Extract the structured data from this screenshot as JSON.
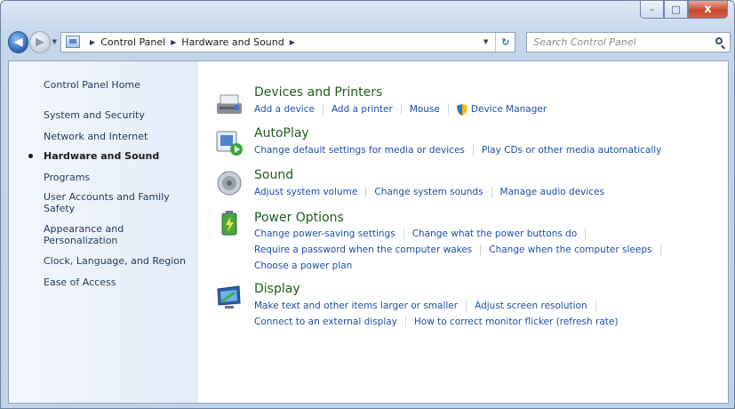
{
  "window": {
    "caption_buttons": {
      "minimize": "–",
      "maximize": "□",
      "close": "x"
    }
  },
  "nav": {
    "back_glyph": "◀",
    "forward_glyph": "▶",
    "dropdown_glyph": "▼"
  },
  "address": {
    "separator_glyph": "▶",
    "crumbs": [
      "Control Panel",
      "Hardware and Sound"
    ],
    "dropdown_glyph": "▼",
    "refresh_glyph": "↻"
  },
  "search": {
    "placeholder": "Search Control Panel"
  },
  "sidebar": {
    "items": [
      {
        "label": "Control Panel Home"
      },
      {
        "label": "System and Security"
      },
      {
        "label": "Network and Internet"
      },
      {
        "label": "Hardware and Sound",
        "active": true
      },
      {
        "label": "Programs"
      },
      {
        "label": "User Accounts and Family Safety"
      },
      {
        "label": "Appearance and Personalization"
      },
      {
        "label": "Clock, Language, and Region"
      },
      {
        "label": "Ease of Access"
      }
    ]
  },
  "categories": [
    {
      "title": "Devices and Printers",
      "icon": "printer-icon",
      "lines": [
        [
          "Add a device",
          "Add a printer",
          "Mouse",
          "Device Manager"
        ]
      ]
    },
    {
      "title": "AutoPlay",
      "icon": "autoplay-icon",
      "lines": [
        [
          "Change default settings for media or devices",
          "Play CDs or other media automatically"
        ]
      ]
    },
    {
      "title": "Sound",
      "icon": "speaker-icon",
      "lines": [
        [
          "Adjust system volume",
          "Change system sounds",
          "Manage audio devices"
        ]
      ]
    },
    {
      "title": "Power Options",
      "icon": "battery-icon",
      "lines": [
        [
          "Change power-saving settings",
          "Change what the power buttons do"
        ],
        [
          "Require a password when the computer wakes",
          "Change when the computer sleeps"
        ],
        [
          "Choose a power plan"
        ]
      ]
    },
    {
      "title": "Display",
      "icon": "monitor-icon",
      "lines": [
        [
          "Make text and other items larger or smaller",
          "Adjust screen resolution"
        ],
        [
          "Connect to an external display",
          "How to correct monitor flicker (refresh rate)"
        ]
      ]
    }
  ],
  "colors": {
    "link": "#1f4ea7",
    "category_title": "#1e5e1a",
    "sidebar_text": "#1e395b"
  }
}
